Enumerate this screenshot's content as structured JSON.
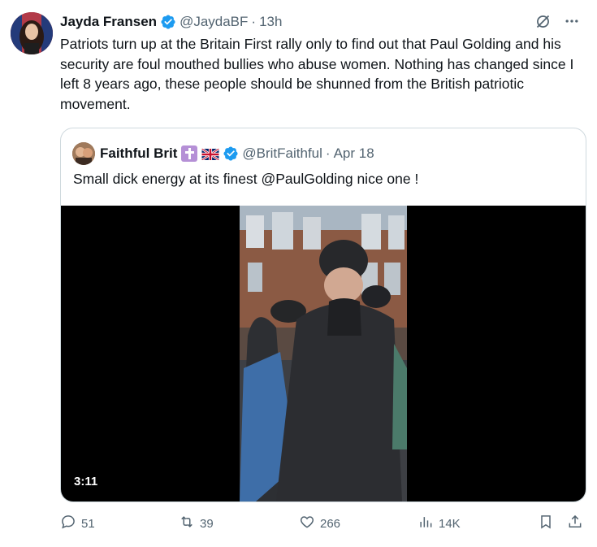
{
  "post": {
    "author_name": "Jayda Fransen",
    "author_handle": "@JaydaBF",
    "separator": "·",
    "time": "13h",
    "text": "Patriots turn up at the Britain First rally only to find out that Paul Golding and his security are foul mouthed bullies who abuse women. Nothing has changed since I left 8 years ago, these people should be shunned from the British patriotic movement."
  },
  "quoted": {
    "author_name": "Faithful Brit",
    "author_handle": "@BritFaithful",
    "separator": "·",
    "date": "Apr 18",
    "text": "Small dick energy at its finest @PaulGolding nice one !",
    "video_duration": "3:11"
  },
  "actions": {
    "replies": "51",
    "reposts": "39",
    "likes": "266",
    "views": "14K"
  },
  "icons": {
    "verified": "verified-badge-icon",
    "grok": "grok-icon",
    "more": "more-icon",
    "reply": "reply-icon",
    "repost": "repost-icon",
    "like": "like-icon",
    "views": "views-icon",
    "bookmark": "bookmark-icon",
    "share": "share-icon"
  },
  "colors": {
    "verified_blue": "#1d9bf0",
    "muted": "#536471",
    "border": "#cfd9de"
  }
}
